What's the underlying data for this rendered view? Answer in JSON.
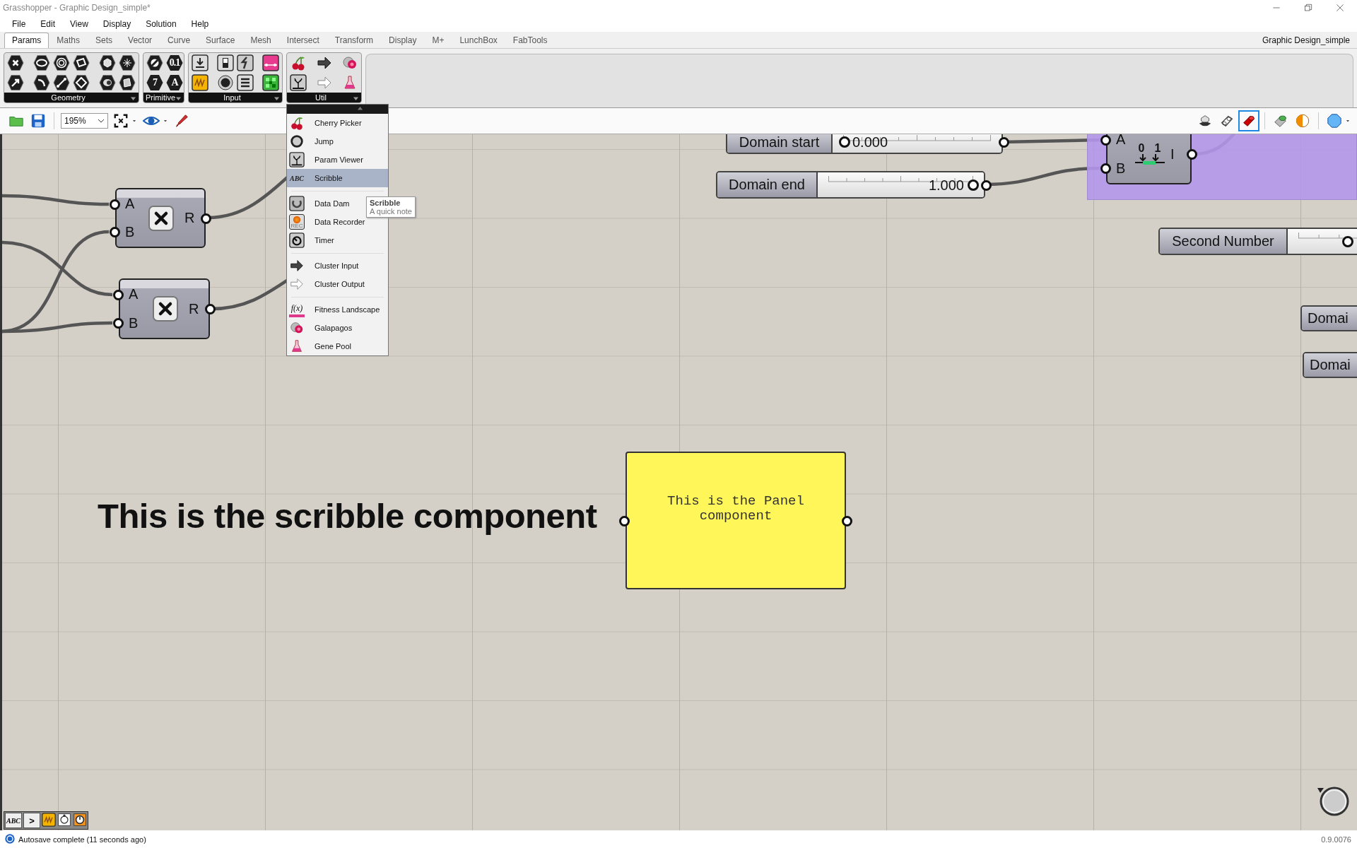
{
  "window": {
    "title": "Grasshopper - Graphic Design_simple*"
  },
  "menu_bar": [
    "File",
    "Edit",
    "View",
    "Display",
    "Solution",
    "Help"
  ],
  "tabs": [
    {
      "label": "Params",
      "selected": true
    },
    {
      "label": "Maths",
      "selected": false
    },
    {
      "label": "Sets",
      "selected": false
    },
    {
      "label": "Vector",
      "selected": false
    },
    {
      "label": "Curve",
      "selected": false
    },
    {
      "label": "Surface",
      "selected": false
    },
    {
      "label": "Mesh",
      "selected": false
    },
    {
      "label": "Intersect",
      "selected": false
    },
    {
      "label": "Transform",
      "selected": false
    },
    {
      "label": "Display",
      "selected": false
    },
    {
      "label": "M+",
      "selected": false
    },
    {
      "label": "LunchBox",
      "selected": false
    },
    {
      "label": "FabTools",
      "selected": false
    }
  ],
  "document_name": "Graphic Design_simple",
  "ribbon_groups": [
    {
      "label": "Geometry"
    },
    {
      "label": "Primitive",
      "icon_texts": [
        "0.1",
        "7",
        "A"
      ]
    },
    {
      "label": "Input"
    },
    {
      "label": "Util"
    }
  ],
  "toolbar": {
    "zoom": "195%"
  },
  "util_menu": {
    "sections": [
      [
        {
          "label": "Cherry Picker",
          "selected": false
        },
        {
          "label": "Jump",
          "selected": false
        },
        {
          "label": "Param Viewer",
          "selected": false
        },
        {
          "label": "Scribble",
          "selected": true,
          "icon_text": "ABC"
        }
      ],
      [
        {
          "label": "Data Dam",
          "selected": false
        },
        {
          "label": "Data Recorder",
          "selected": false,
          "icon_text": "REC"
        },
        {
          "label": "Timer",
          "selected": false
        }
      ],
      [
        {
          "label": "Cluster Input",
          "selected": false
        },
        {
          "label": "Cluster Output",
          "selected": false
        }
      ],
      [
        {
          "label": "Fitness Landscape",
          "selected": false,
          "icon_text": "f(x)"
        },
        {
          "label": "Galapagos",
          "selected": false
        },
        {
          "label": "Gene Pool",
          "selected": false
        }
      ]
    ]
  },
  "tooltip": {
    "title": "Scribble",
    "text": "A quick note"
  },
  "canvas": {
    "multiply_nodes": [
      {
        "inputs": [
          "A",
          "B"
        ],
        "output": "R"
      },
      {
        "inputs": [
          "A",
          "B"
        ],
        "output": "R"
      }
    ],
    "sliders": [
      {
        "label": "Domain start",
        "value": "0.000",
        "level": 0
      },
      {
        "label": "Domain end",
        "value": "1.000",
        "level": 1
      },
      {
        "label": "Second Number",
        "level": 0.3
      }
    ],
    "domain_node": {
      "inputs": [
        "A",
        "B"
      ],
      "output": "I",
      "icon_texts": [
        "0",
        "1"
      ]
    },
    "clipped_nodes": [
      "Domai",
      "Domai"
    ],
    "scribble": "This is the scribble component",
    "panel": "This is the Panel component"
  },
  "canvas_toolbar": [
    "ABC",
    ">"
  ],
  "status_bar": {
    "message": "Autosave complete (11 seconds ago)",
    "version": "0.9.0076"
  }
}
